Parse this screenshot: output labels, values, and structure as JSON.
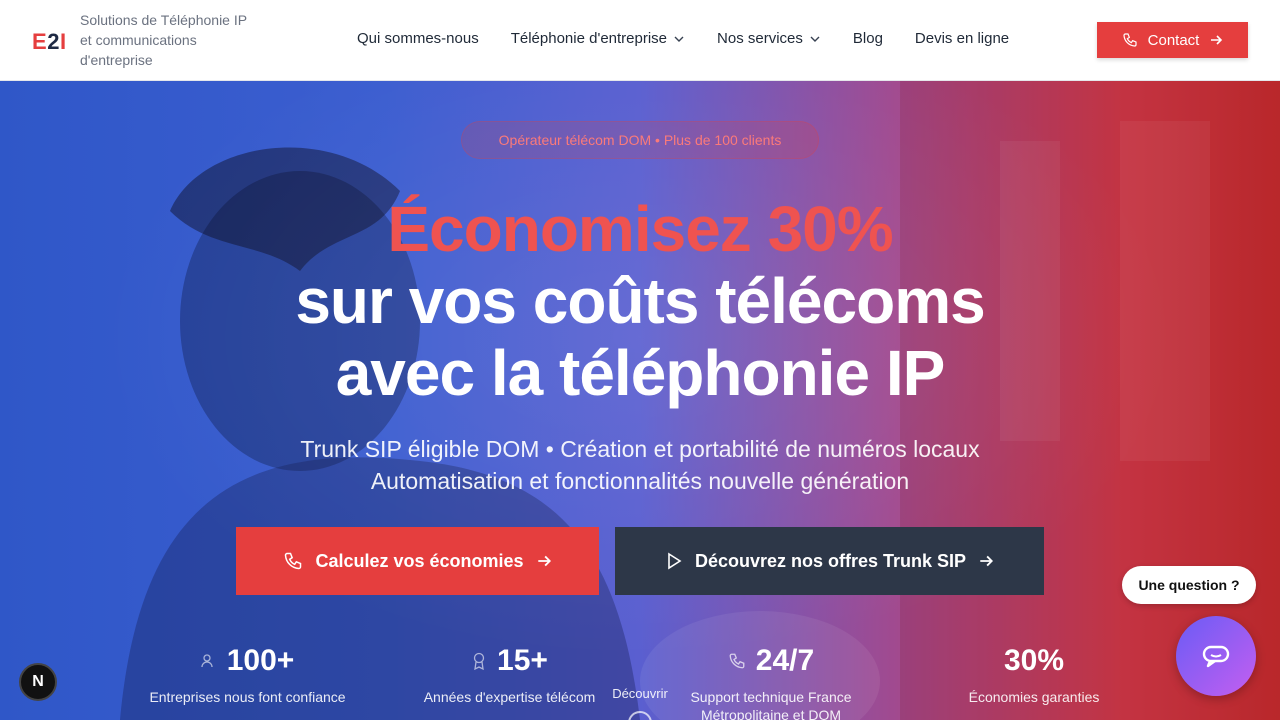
{
  "header": {
    "logo": {
      "e": "E",
      "two": "2",
      "i": "I"
    },
    "tagline": "Solutions de Téléphonie IP et communications d'entreprise",
    "nav": [
      {
        "label": "Qui sommes-nous",
        "has_dropdown": false
      },
      {
        "label": "Téléphonie d'entreprise",
        "has_dropdown": true
      },
      {
        "label": "Nos services",
        "has_dropdown": true
      },
      {
        "label": "Blog",
        "has_dropdown": false
      },
      {
        "label": "Devis en ligne",
        "has_dropdown": false
      }
    ],
    "contact_label": "Contact"
  },
  "hero": {
    "pill": "Opérateur télécom DOM • Plus de 100 clients",
    "title_accent": "Économisez 30%",
    "title_line2": "sur vos coûts télécoms",
    "title_line3": "avec la téléphonie IP",
    "subtitle_line1": "Trunk SIP éligible DOM • Création et portabilité de numéros locaux",
    "subtitle_line2": "Automatisation et fonctionnalités nouvelle génération",
    "cta_primary": "Calculez vos économies",
    "cta_secondary": "Découvrez nos offres Trunk SIP",
    "scroll_label": "Découvrir",
    "stats": [
      {
        "value": "100+",
        "label": "Entreprises nous font confiance",
        "icon": "users-icon"
      },
      {
        "value": "15+",
        "label": "Années d'expertise télécom",
        "icon": "award-icon"
      },
      {
        "value": "24/7",
        "label": "Support technique France Métropolitaine et DOM",
        "icon": "phone-icon"
      },
      {
        "value": "30%",
        "label": "Économies garanties",
        "icon": ""
      }
    ]
  },
  "widgets": {
    "question": "Une question ?",
    "badge": "N"
  },
  "colors": {
    "accent": "#e53e3e",
    "dark_button": "#2d3748",
    "chat_gradient_start": "#6a5cf5",
    "chat_gradient_end": "#c45ef0"
  }
}
